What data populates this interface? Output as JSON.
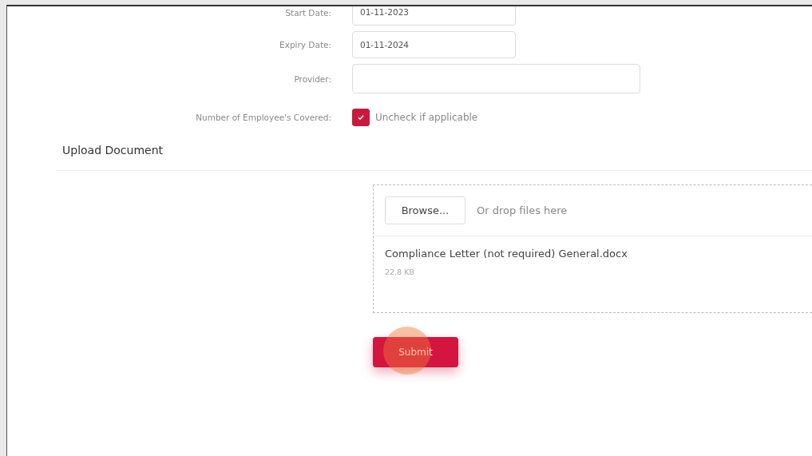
{
  "fields": [
    {
      "label": "Start Date:",
      "value": "01-11-2023",
      "kind": "short"
    },
    {
      "label": "Expiry Date:",
      "value": "01-11-2024",
      "kind": "short"
    },
    {
      "label": "Provider:",
      "kind": "long"
    }
  ],
  "coverage": {
    "label": "Number of Employee's Covered:",
    "checked": true,
    "text": "Uncheck if applicable"
  },
  "upload": {
    "title": "Upload Document",
    "browse": "Browse...",
    "hint": "Or drop files here",
    "files": [
      {
        "name": "Compliance Letter (not required) General.docx",
        "size": "22.8 KB"
      }
    ]
  },
  "submit": "Submit"
}
